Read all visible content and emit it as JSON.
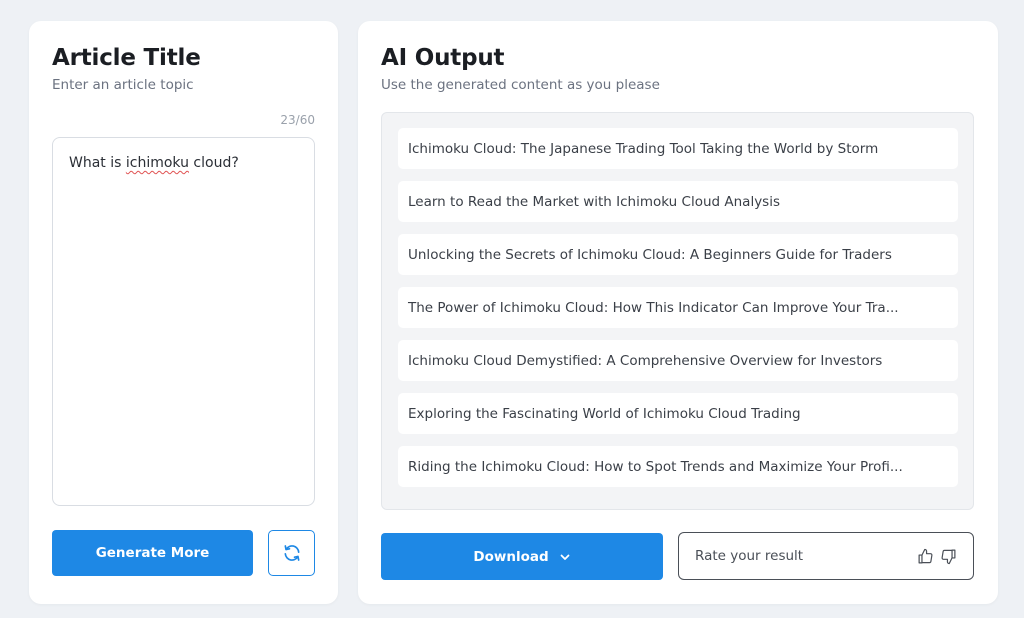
{
  "left": {
    "title": "Article Title",
    "subtitle": "Enter an article topic",
    "char_count": "23/60",
    "topic_text_before": "What is ",
    "topic_text_misspelled": "ichimoku",
    "topic_text_after": " cloud?",
    "generate_label": "Generate More",
    "refresh_icon": "refresh-icon"
  },
  "right": {
    "title": "AI Output",
    "subtitle": "Use the generated content as you please",
    "items": [
      "Ichimoku Cloud: The Japanese Trading Tool Taking the World by Storm",
      "Learn to Read the Market with Ichimoku Cloud Analysis",
      "Unlocking the Secrets of Ichimoku Cloud: A Beginners Guide for Traders",
      "The Power of Ichimoku Cloud: How This Indicator Can Improve Your Tra...",
      "Ichimoku Cloud Demystified: A Comprehensive Overview for Investors",
      "Exploring the Fascinating World of Ichimoku Cloud Trading",
      "Riding the Ichimoku Cloud: How to Spot Trends and Maximize Your Profi..."
    ],
    "download_label": "Download",
    "rate_label": "Rate your result"
  },
  "colors": {
    "accent": "#1e88e5",
    "background": "#eef1f5"
  }
}
